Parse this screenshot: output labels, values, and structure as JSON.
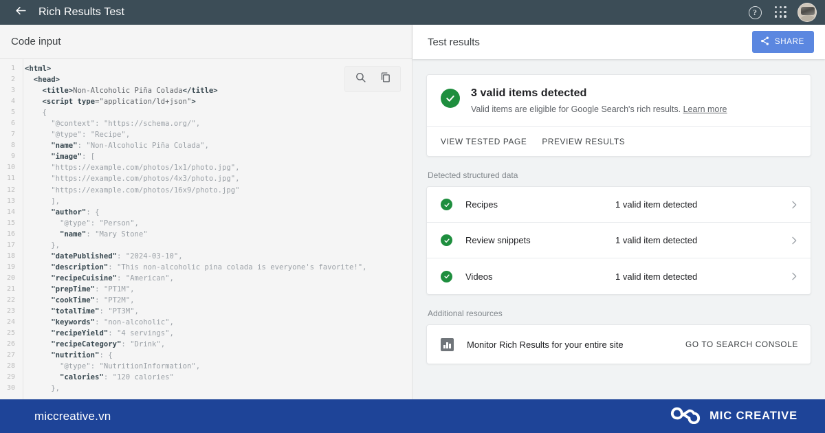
{
  "topbar": {
    "title": "Rich Results Test",
    "back_icon": "arrow-back-icon",
    "help_icon": "help-icon",
    "help_glyph": "?",
    "apps_icon": "apps-grid-icon",
    "avatar_icon": "user-avatar",
    "background_color": "#3c4d57"
  },
  "left_pane": {
    "header_title": "Code input",
    "tools": {
      "search_icon": "search-icon",
      "copy_icon": "copy-icon"
    },
    "code_lines": [
      {
        "n": 1,
        "tokens": [
          {
            "t": "tag",
            "s": "<html>"
          }
        ]
      },
      {
        "n": 2,
        "tokens": [
          {
            "t": "plain",
            "s": "  "
          },
          {
            "t": "tag",
            "s": "<head>"
          }
        ]
      },
      {
        "n": 3,
        "tokens": [
          {
            "t": "plain",
            "s": "    "
          },
          {
            "t": "tag",
            "s": "<title>"
          },
          {
            "t": "plain",
            "s": "Non-Alcoholic Piña Colada"
          },
          {
            "t": "tag",
            "s": "</title>"
          }
        ]
      },
      {
        "n": 4,
        "tokens": [
          {
            "t": "plain",
            "s": "    "
          },
          {
            "t": "tag",
            "s": "<script "
          },
          {
            "t": "attr",
            "s": "type"
          },
          {
            "t": "plain",
            "s": "="
          },
          {
            "t": "plain",
            "s": "\"application/ld+json\""
          },
          {
            "t": "tag",
            "s": ">"
          }
        ]
      },
      {
        "n": 5,
        "tokens": [
          {
            "t": "plain",
            "s": "    "
          },
          {
            "t": "punct",
            "s": "{"
          }
        ]
      },
      {
        "n": 6,
        "tokens": [
          {
            "t": "plain",
            "s": "      "
          },
          {
            "t": "str",
            "s": "\"@context\""
          },
          {
            "t": "punct",
            "s": ": "
          },
          {
            "t": "str",
            "s": "\"https://schema.org/\","
          }
        ]
      },
      {
        "n": 7,
        "tokens": [
          {
            "t": "plain",
            "s": "      "
          },
          {
            "t": "str",
            "s": "\"@type\""
          },
          {
            "t": "punct",
            "s": ": "
          },
          {
            "t": "str",
            "s": "\"Recipe\","
          }
        ]
      },
      {
        "n": 8,
        "tokens": [
          {
            "t": "plain",
            "s": "      "
          },
          {
            "t": "key",
            "s": "\"name\""
          },
          {
            "t": "punct",
            "s": ": "
          },
          {
            "t": "str",
            "s": "\"Non-Alcoholic Piña Colada\","
          }
        ]
      },
      {
        "n": 9,
        "tokens": [
          {
            "t": "plain",
            "s": "      "
          },
          {
            "t": "key",
            "s": "\"image\""
          },
          {
            "t": "punct",
            "s": ": ["
          }
        ]
      },
      {
        "n": 10,
        "tokens": [
          {
            "t": "plain",
            "s": "      "
          },
          {
            "t": "str",
            "s": "\"https://example.com/photos/1x1/photo.jpg\","
          }
        ]
      },
      {
        "n": 11,
        "tokens": [
          {
            "t": "plain",
            "s": "      "
          },
          {
            "t": "str",
            "s": "\"https://example.com/photos/4x3/photo.jpg\","
          }
        ]
      },
      {
        "n": 12,
        "tokens": [
          {
            "t": "plain",
            "s": "      "
          },
          {
            "t": "str",
            "s": "\"https://example.com/photos/16x9/photo.jpg\""
          }
        ]
      },
      {
        "n": 13,
        "tokens": [
          {
            "t": "plain",
            "s": "      "
          },
          {
            "t": "punct",
            "s": "],"
          }
        ]
      },
      {
        "n": 14,
        "tokens": [
          {
            "t": "plain",
            "s": "      "
          },
          {
            "t": "key",
            "s": "\"author\""
          },
          {
            "t": "punct",
            "s": ": {"
          }
        ]
      },
      {
        "n": 15,
        "tokens": [
          {
            "t": "plain",
            "s": "        "
          },
          {
            "t": "str",
            "s": "\"@type\""
          },
          {
            "t": "punct",
            "s": ": "
          },
          {
            "t": "str",
            "s": "\"Person\","
          }
        ]
      },
      {
        "n": 16,
        "tokens": [
          {
            "t": "plain",
            "s": "        "
          },
          {
            "t": "key",
            "s": "\"name\""
          },
          {
            "t": "punct",
            "s": ": "
          },
          {
            "t": "str",
            "s": "\"Mary Stone\""
          }
        ]
      },
      {
        "n": 17,
        "tokens": [
          {
            "t": "plain",
            "s": "      "
          },
          {
            "t": "punct",
            "s": "},"
          }
        ]
      },
      {
        "n": 18,
        "tokens": [
          {
            "t": "plain",
            "s": "      "
          },
          {
            "t": "key",
            "s": "\"datePublished\""
          },
          {
            "t": "punct",
            "s": ": "
          },
          {
            "t": "str",
            "s": "\"2024-03-10\","
          }
        ]
      },
      {
        "n": 19,
        "tokens": [
          {
            "t": "plain",
            "s": "      "
          },
          {
            "t": "key",
            "s": "\"description\""
          },
          {
            "t": "punct",
            "s": ": "
          },
          {
            "t": "str",
            "s": "\"This non-alcoholic pina colada is everyone's favorite!\","
          }
        ]
      },
      {
        "n": 20,
        "tokens": [
          {
            "t": "plain",
            "s": "      "
          },
          {
            "t": "key",
            "s": "\"recipeCuisine\""
          },
          {
            "t": "punct",
            "s": ": "
          },
          {
            "t": "str",
            "s": "\"American\","
          }
        ]
      },
      {
        "n": 21,
        "tokens": [
          {
            "t": "plain",
            "s": "      "
          },
          {
            "t": "key",
            "s": "\"prepTime\""
          },
          {
            "t": "punct",
            "s": ": "
          },
          {
            "t": "str",
            "s": "\"PT1M\","
          }
        ]
      },
      {
        "n": 22,
        "tokens": [
          {
            "t": "plain",
            "s": "      "
          },
          {
            "t": "key",
            "s": "\"cookTime\""
          },
          {
            "t": "punct",
            "s": ": "
          },
          {
            "t": "str",
            "s": "\"PT2M\","
          }
        ]
      },
      {
        "n": 23,
        "tokens": [
          {
            "t": "plain",
            "s": "      "
          },
          {
            "t": "key",
            "s": "\"totalTime\""
          },
          {
            "t": "punct",
            "s": ": "
          },
          {
            "t": "str",
            "s": "\"PT3M\","
          }
        ]
      },
      {
        "n": 24,
        "tokens": [
          {
            "t": "plain",
            "s": "      "
          },
          {
            "t": "key",
            "s": "\"keywords\""
          },
          {
            "t": "punct",
            "s": ": "
          },
          {
            "t": "str",
            "s": "\"non-alcoholic\","
          }
        ]
      },
      {
        "n": 25,
        "tokens": [
          {
            "t": "plain",
            "s": "      "
          },
          {
            "t": "key",
            "s": "\"recipeYield\""
          },
          {
            "t": "punct",
            "s": ": "
          },
          {
            "t": "str",
            "s": "\"4 servings\","
          }
        ]
      },
      {
        "n": 26,
        "tokens": [
          {
            "t": "plain",
            "s": "      "
          },
          {
            "t": "key",
            "s": "\"recipeCategory\""
          },
          {
            "t": "punct",
            "s": ": "
          },
          {
            "t": "str",
            "s": "\"Drink\","
          }
        ]
      },
      {
        "n": 27,
        "tokens": [
          {
            "t": "plain",
            "s": "      "
          },
          {
            "t": "key",
            "s": "\"nutrition\""
          },
          {
            "t": "punct",
            "s": ": {"
          }
        ]
      },
      {
        "n": 28,
        "tokens": [
          {
            "t": "plain",
            "s": "        "
          },
          {
            "t": "str",
            "s": "\"@type\""
          },
          {
            "t": "punct",
            "s": ": "
          },
          {
            "t": "str",
            "s": "\"NutritionInformation\","
          }
        ]
      },
      {
        "n": 29,
        "tokens": [
          {
            "t": "plain",
            "s": "        "
          },
          {
            "t": "key",
            "s": "\"calories\""
          },
          {
            "t": "punct",
            "s": ": "
          },
          {
            "t": "str",
            "s": "\"120 calories\""
          }
        ]
      },
      {
        "n": 30,
        "tokens": [
          {
            "t": "plain",
            "s": "      "
          },
          {
            "t": "punct",
            "s": "},"
          }
        ]
      }
    ]
  },
  "right_pane": {
    "header_title": "Test results",
    "share_button": {
      "label": "SHARE",
      "icon": "share-icon",
      "color": "#5b87e0"
    },
    "summary": {
      "status_icon": "check-circle-icon",
      "status_color": "#1e8e3e",
      "title": "3 valid items detected",
      "subtitle": "Valid items are eligible for Google Search's rich results.",
      "learn_more_label": "Learn more",
      "actions": [
        {
          "label": "VIEW TESTED PAGE"
        },
        {
          "label": "PREVIEW RESULTS"
        }
      ]
    },
    "detected_section_label": "Detected structured data",
    "detected_items": [
      {
        "name": "Recipes",
        "status": "1 valid item detected",
        "icon": "check-circle-icon",
        "chevron": "chevron-right-icon"
      },
      {
        "name": "Review snippets",
        "status": "1 valid item detected",
        "icon": "check-circle-icon",
        "chevron": "chevron-right-icon"
      },
      {
        "name": "Videos",
        "status": "1 valid item detected",
        "icon": "check-circle-icon",
        "chevron": "chevron-right-icon"
      }
    ],
    "additional_section_label": "Additional resources",
    "additional_items": [
      {
        "icon": "bar-chart-icon",
        "text": "Monitor Rich Results for your entire site",
        "action_label": "GO TO SEARCH CONSOLE"
      }
    ]
  },
  "footer": {
    "site": "miccreative.vn",
    "brand": "MIC CREATIVE",
    "logo_icon": "infinity-loops-logo",
    "background_color": "#1e4498"
  }
}
